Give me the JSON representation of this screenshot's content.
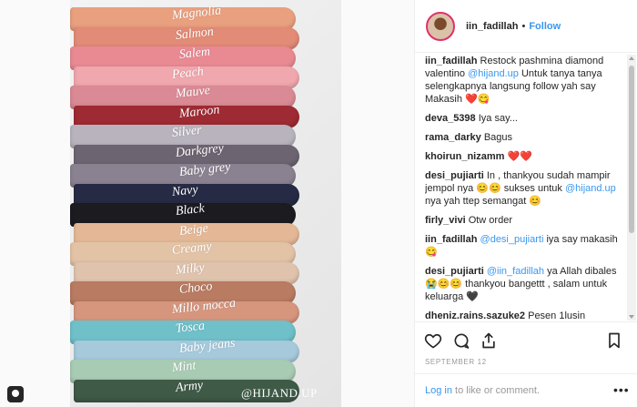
{
  "photo": {
    "labels": [
      "Magnolia",
      "Salmon",
      "Salem",
      "Peach",
      "Mauve",
      "Maroon",
      "Silver",
      "Darkgrey",
      "Baby grey",
      "Navy",
      "Black",
      "Beige",
      "Creamy",
      "Milky",
      "Choco",
      "Millo mocca",
      "Tosca",
      "Baby jeans",
      "Mint",
      "Army"
    ],
    "colors": [
      "#e9a07f",
      "#e28b76",
      "#e98a93",
      "#f0a7ad",
      "#d98a94",
      "#9e2a33",
      "#b8b3bd",
      "#6d6471",
      "#8a8290",
      "#262a44",
      "#1b1b20",
      "#e4b896",
      "#e3c3a6",
      "#dfc3ad",
      "#b97b62",
      "#d6967e",
      "#6fc0c9",
      "#a6c9dc",
      "#a8cbb4",
      "#3f5a47"
    ],
    "watermark": "@HIJAND.UP"
  },
  "header": {
    "username": "iin_fadillah",
    "separator": "•",
    "follow_label": "Follow"
  },
  "comments": [
    {
      "user": "iin_fadillah",
      "parts": [
        {
          "t": " Restock pashmina diamond valentino "
        },
        {
          "t": "@hijand.up",
          "m": true
        },
        {
          "t": " Untuk tanya tanya selengkapnya langsung follow yah say Makasih ❤️😋"
        }
      ]
    },
    {
      "user": "deva_5398",
      "parts": [
        {
          "t": " Iya say..."
        }
      ]
    },
    {
      "user": "rama_darky",
      "parts": [
        {
          "t": " Bagus"
        }
      ]
    },
    {
      "user": "khoirun_nizamm",
      "parts": [
        {
          "t": " ❤️❤️"
        }
      ]
    },
    {
      "user": "desi_pujiarti",
      "parts": [
        {
          "t": " In , thankyou sudah mampir jempol nya 😊😊 sukses untuk "
        },
        {
          "t": "@hijand.up",
          "m": true
        },
        {
          "t": " nya yah ttep semangat 😊"
        }
      ]
    },
    {
      "user": "firly_vivi",
      "parts": [
        {
          "t": " Otw order"
        }
      ]
    },
    {
      "user": "iin_fadillah",
      "parts": [
        {
          "t": " "
        },
        {
          "t": "@desi_pujiarti",
          "m": true
        },
        {
          "t": " iya say makasih 😋"
        }
      ]
    },
    {
      "user": "desi_pujiarti",
      "parts": [
        {
          "t": " "
        },
        {
          "t": "@iin_fadillah",
          "m": true
        },
        {
          "t": " ya Allah dibales 😭😊😊 thankyou bangettt , salam untuk keluarga 🖤"
        }
      ]
    },
    {
      "user": "dheniz.rains.sazuke2",
      "parts": [
        {
          "t": " Pesen 1lusin"
        }
      ]
    }
  ],
  "post": {
    "date": "September 12"
  },
  "footer": {
    "login_label": "Log in",
    "rest_text": " to like or comment.",
    "more_label": "•••"
  }
}
